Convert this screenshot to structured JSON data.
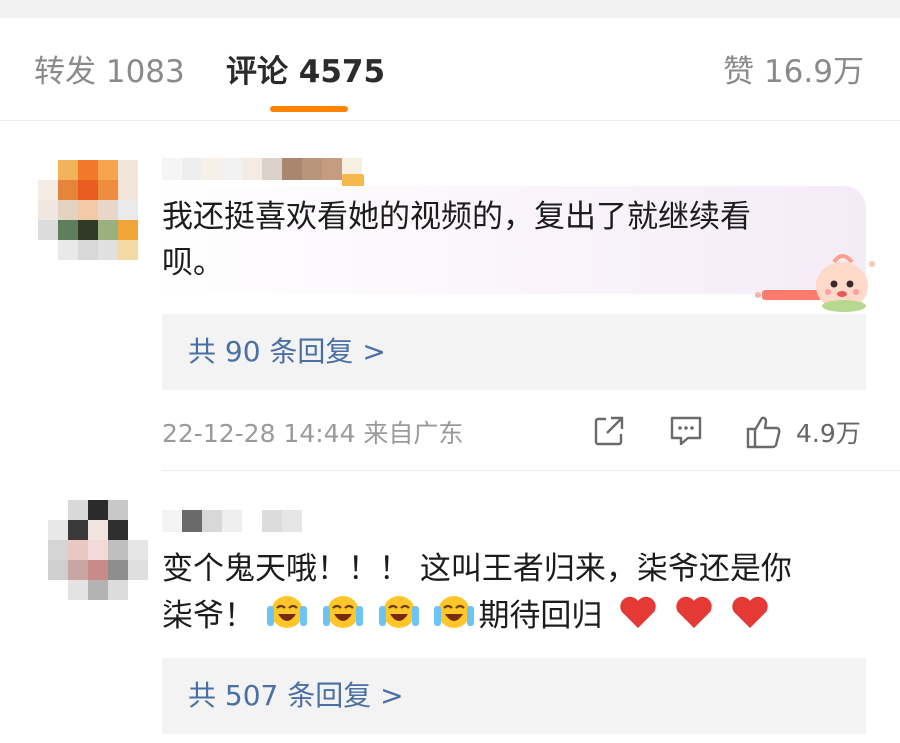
{
  "tabs": {
    "repost_label": "转发 1083",
    "comments_label": "评论 4575",
    "likes_label": "赞 16.9万"
  },
  "comments": [
    {
      "text_line1": "我还挺喜欢看她的视频的，复出了就继续看",
      "text_line2": "呗。",
      "reply_label": "共 90 条回复 >",
      "time_location": "22-12-28 14:44 来自广东",
      "like_count": "4.9万"
    },
    {
      "text_line1": "变个鬼天哦！！！ 这叫王者归来，柒爷还是你",
      "text_line2_start": "柒爷！",
      "text_line2_end": "期待回归",
      "reply_label": "共 507 条回复 >"
    }
  ],
  "icons": {
    "share": "share-icon",
    "comment": "comment-icon",
    "like": "thumbs-up-icon",
    "crying_laugh": "crying-laughing-emoji",
    "heart": "red-heart-emoji",
    "sticker": "peach-character-sticker"
  },
  "colors": {
    "accent": "#ff8200",
    "link": "#4a6fa5",
    "heart": "#e53935"
  }
}
